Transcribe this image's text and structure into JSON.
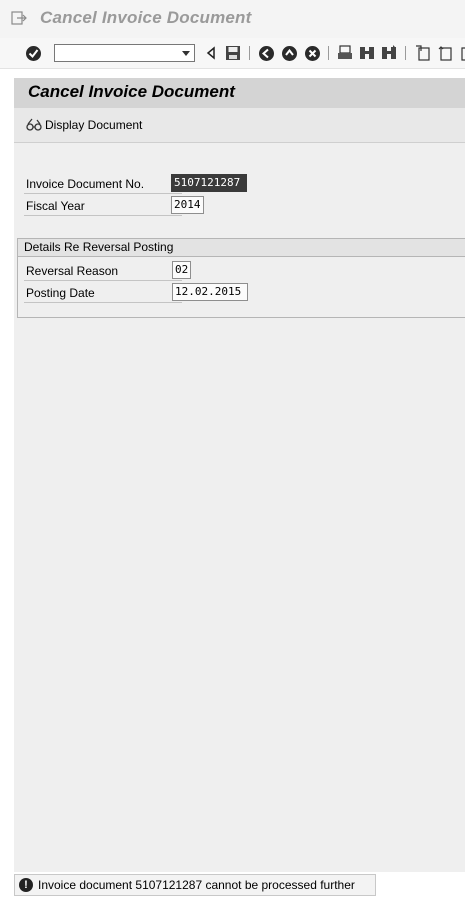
{
  "window": {
    "title": "Cancel Invoice Document"
  },
  "toolbar": {
    "command_field_value": "",
    "icons": [
      "enter-check-icon",
      "back-arrow-icon",
      "save-icon",
      "back-nav-icon",
      "exit-icon",
      "cancel-icon",
      "print-icon",
      "find-icon",
      "find-next-icon",
      "first-page-icon",
      "prev-page-icon"
    ]
  },
  "screen": {
    "title": "Cancel Invoice Document"
  },
  "app_toolbar": {
    "display_document_label": "Display Document"
  },
  "form": {
    "invoice_doc_label": "Invoice Document No.",
    "invoice_doc_value": "5107121287",
    "fiscal_year_label": "Fiscal Year",
    "fiscal_year_value": "2014"
  },
  "reversal_group": {
    "title": "Details Re Reversal Posting",
    "reason_label": "Reversal Reason",
    "reason_value": "02",
    "posting_date_label": "Posting Date",
    "posting_date_value": "12.02.2015"
  },
  "status_bar": {
    "icon": "exclamation-icon",
    "message": "Invoice document 5107121287 cannot be processed further"
  }
}
